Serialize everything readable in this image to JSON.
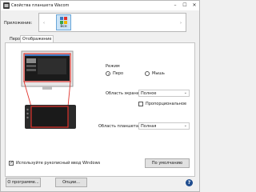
{
  "window": {
    "title": "Свойства планшета Wacom",
    "minimize_icon": "minimize-icon",
    "maximize_icon": "maximize-icon",
    "close_icon": "close-icon"
  },
  "applications": {
    "label": "Приложение:",
    "tiles": [
      {
        "label": "Все",
        "icon": "app-grid-icon",
        "selected": true
      }
    ]
  },
  "tabs": [
    {
      "label": "Перо",
      "active": false
    },
    {
      "label": "Отображение",
      "active": true
    }
  ],
  "mode": {
    "label": "Режим",
    "options": [
      {
        "label": "Перо",
        "selected": true
      },
      {
        "label": "Мышь",
        "selected": false
      }
    ]
  },
  "screen_area": {
    "label": "Область экрана",
    "value": "Полное"
  },
  "proportional": {
    "label": "Пропорциональное",
    "checked": false
  },
  "tablet_area": {
    "label": "Область планшета",
    "value": "Полная"
  },
  "windows_ink": {
    "label": "Используйте рукописный ввод Windows",
    "checked": true
  },
  "buttons": {
    "default": "По умолчанию",
    "about": "О программе...",
    "options": "Опции..."
  },
  "colors": {
    "mapping_red": "#e0322b",
    "accent": "#1f4d8f"
  }
}
